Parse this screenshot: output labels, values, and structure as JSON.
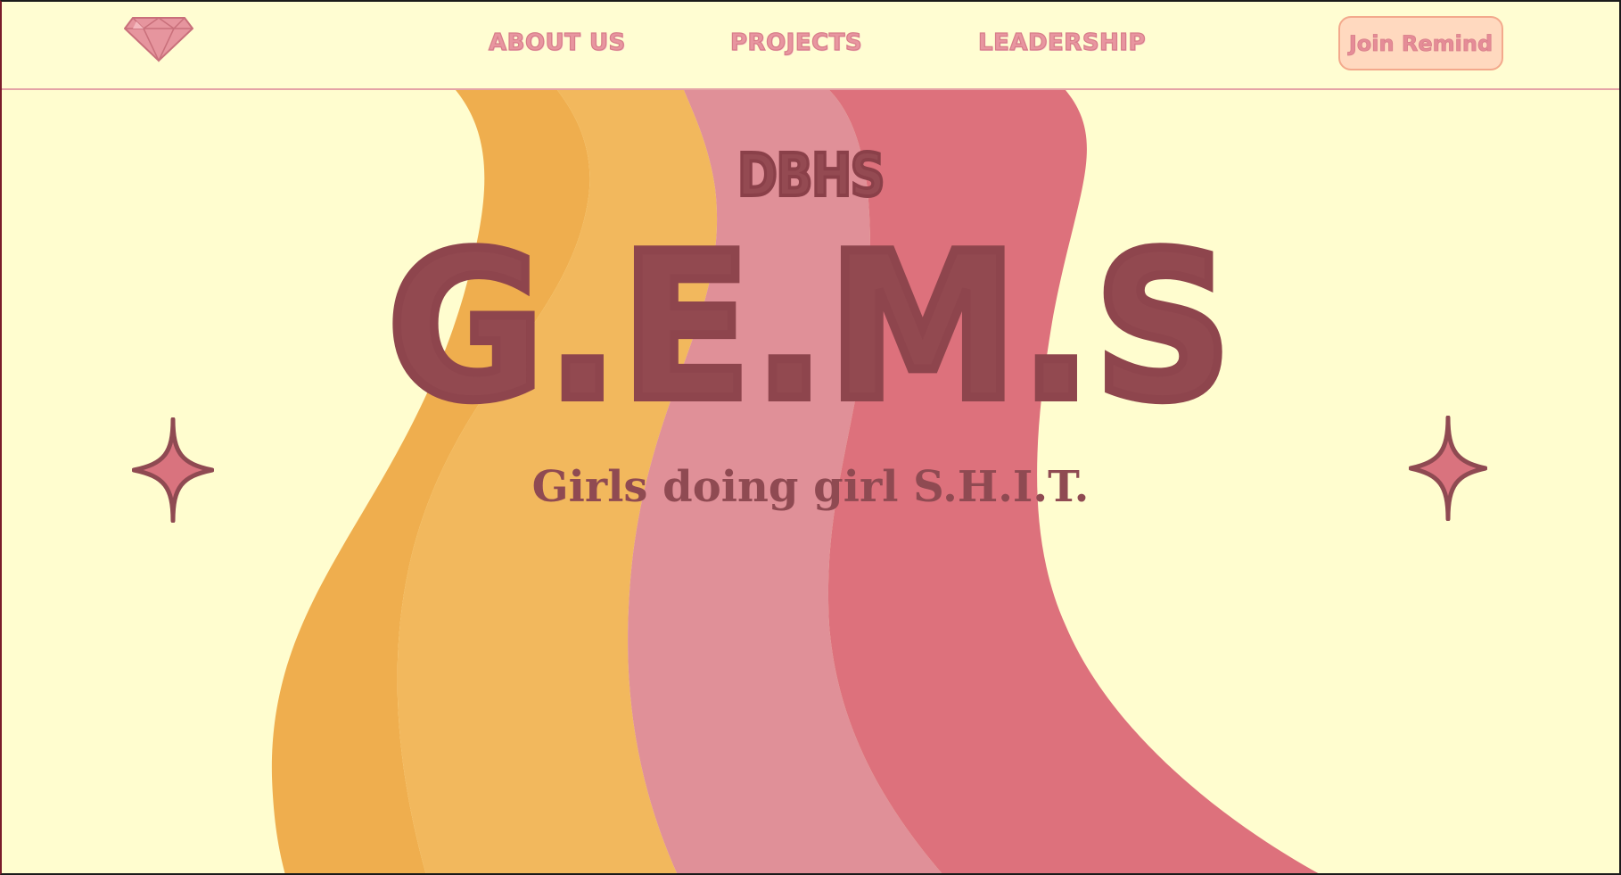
{
  "nav": {
    "logo_icon": "diamond-gem-icon",
    "links": [
      "ABOUT US",
      "PROJECTS",
      "LEADERSHIP"
    ],
    "cta_label": "Join Remind"
  },
  "hero": {
    "kicker": "DBHS",
    "title": "G.E.M.S",
    "tagline": "Girls doing girl S.H.I.T."
  },
  "decorations": {
    "sparkle_icon": "four-point-star-icon"
  },
  "colors": {
    "background": "#FFFDCF",
    "nav_text": "#E896A0",
    "cta_fill": "#FFD9BF",
    "cta_border": "#F3A98C",
    "title_maroon": "#924950",
    "wave_orange": "#EFAE4E",
    "wave_light_orange": "#F2B85D",
    "wave_pink": "#E09098",
    "wave_rose": "#DD717C",
    "sparkle_fill": "#D9737E"
  }
}
